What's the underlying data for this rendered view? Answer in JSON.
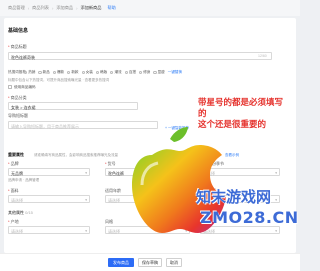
{
  "breadcrumb": {
    "items": [
      "商品管理",
      "商品列表",
      "添加商品",
      "添加新商品"
    ],
    "link": "帮助"
  },
  "form": {
    "section_basic": "基础信息",
    "title_label": "商品标题",
    "title_value": "驼色连裤奇装",
    "title_counter": "12/60",
    "hot_words_label": "热搜词推荐",
    "hot_words": [
      "热销",
      "新品",
      "爆款",
      "新款",
      "女装",
      "韩版",
      "潮流",
      "百搭",
      "修身",
      "显瘦"
    ],
    "hot_words_link": "一键替换",
    "hot_hint": "标题中包含以下热搜词，可提升商品搜索曝光量 · 查看更多热搜词",
    "hot_hint2": "使用商品编码",
    "category_label": "商品分类",
    "category_value": "女装 > 连衣裙",
    "annotation_line1": "带星号的都是必须填写的",
    "annotation_line2": "这个还是很重要的",
    "import_label": "导购短标题",
    "import_placeholder": "请输入导购短标题，用于商品推荐展示",
    "import_link": "+ 一键智能推荐",
    "section_attr": "重要属性",
    "attr_hint": "请准确填写商品属性，会影响商品搜索推荐曝光及流量",
    "attr_link": "点此反馈",
    "attr_link2": "查看示例",
    "brand_label": "品牌",
    "brand_value": "无品牌",
    "brand_hint": "品牌申请 · 品牌管理",
    "model_label": "货号",
    "model_value": "驼色连裤",
    "origin_label": "上市年份季节",
    "origin_value": "",
    "material_label": "面料",
    "material_value": "",
    "color_label": "适用年龄",
    "color_value": "",
    "fabric_label": "面料材质",
    "fabric_value": "",
    "suitable_label": "风格",
    "suitable_value": "",
    "other_section": "其他属性",
    "other_counter": "0/15",
    "other_label": "产地",
    "other_value": "",
    "other_label2": "适用人群",
    "other_value2": "",
    "select_placeholder": "请选择"
  },
  "buttons": {
    "publish": "发布商品",
    "save": "保存草稿",
    "cancel": "取消"
  },
  "watermark": {
    "text1": "知末游戏网",
    "text2": "ZMO28.CN"
  }
}
